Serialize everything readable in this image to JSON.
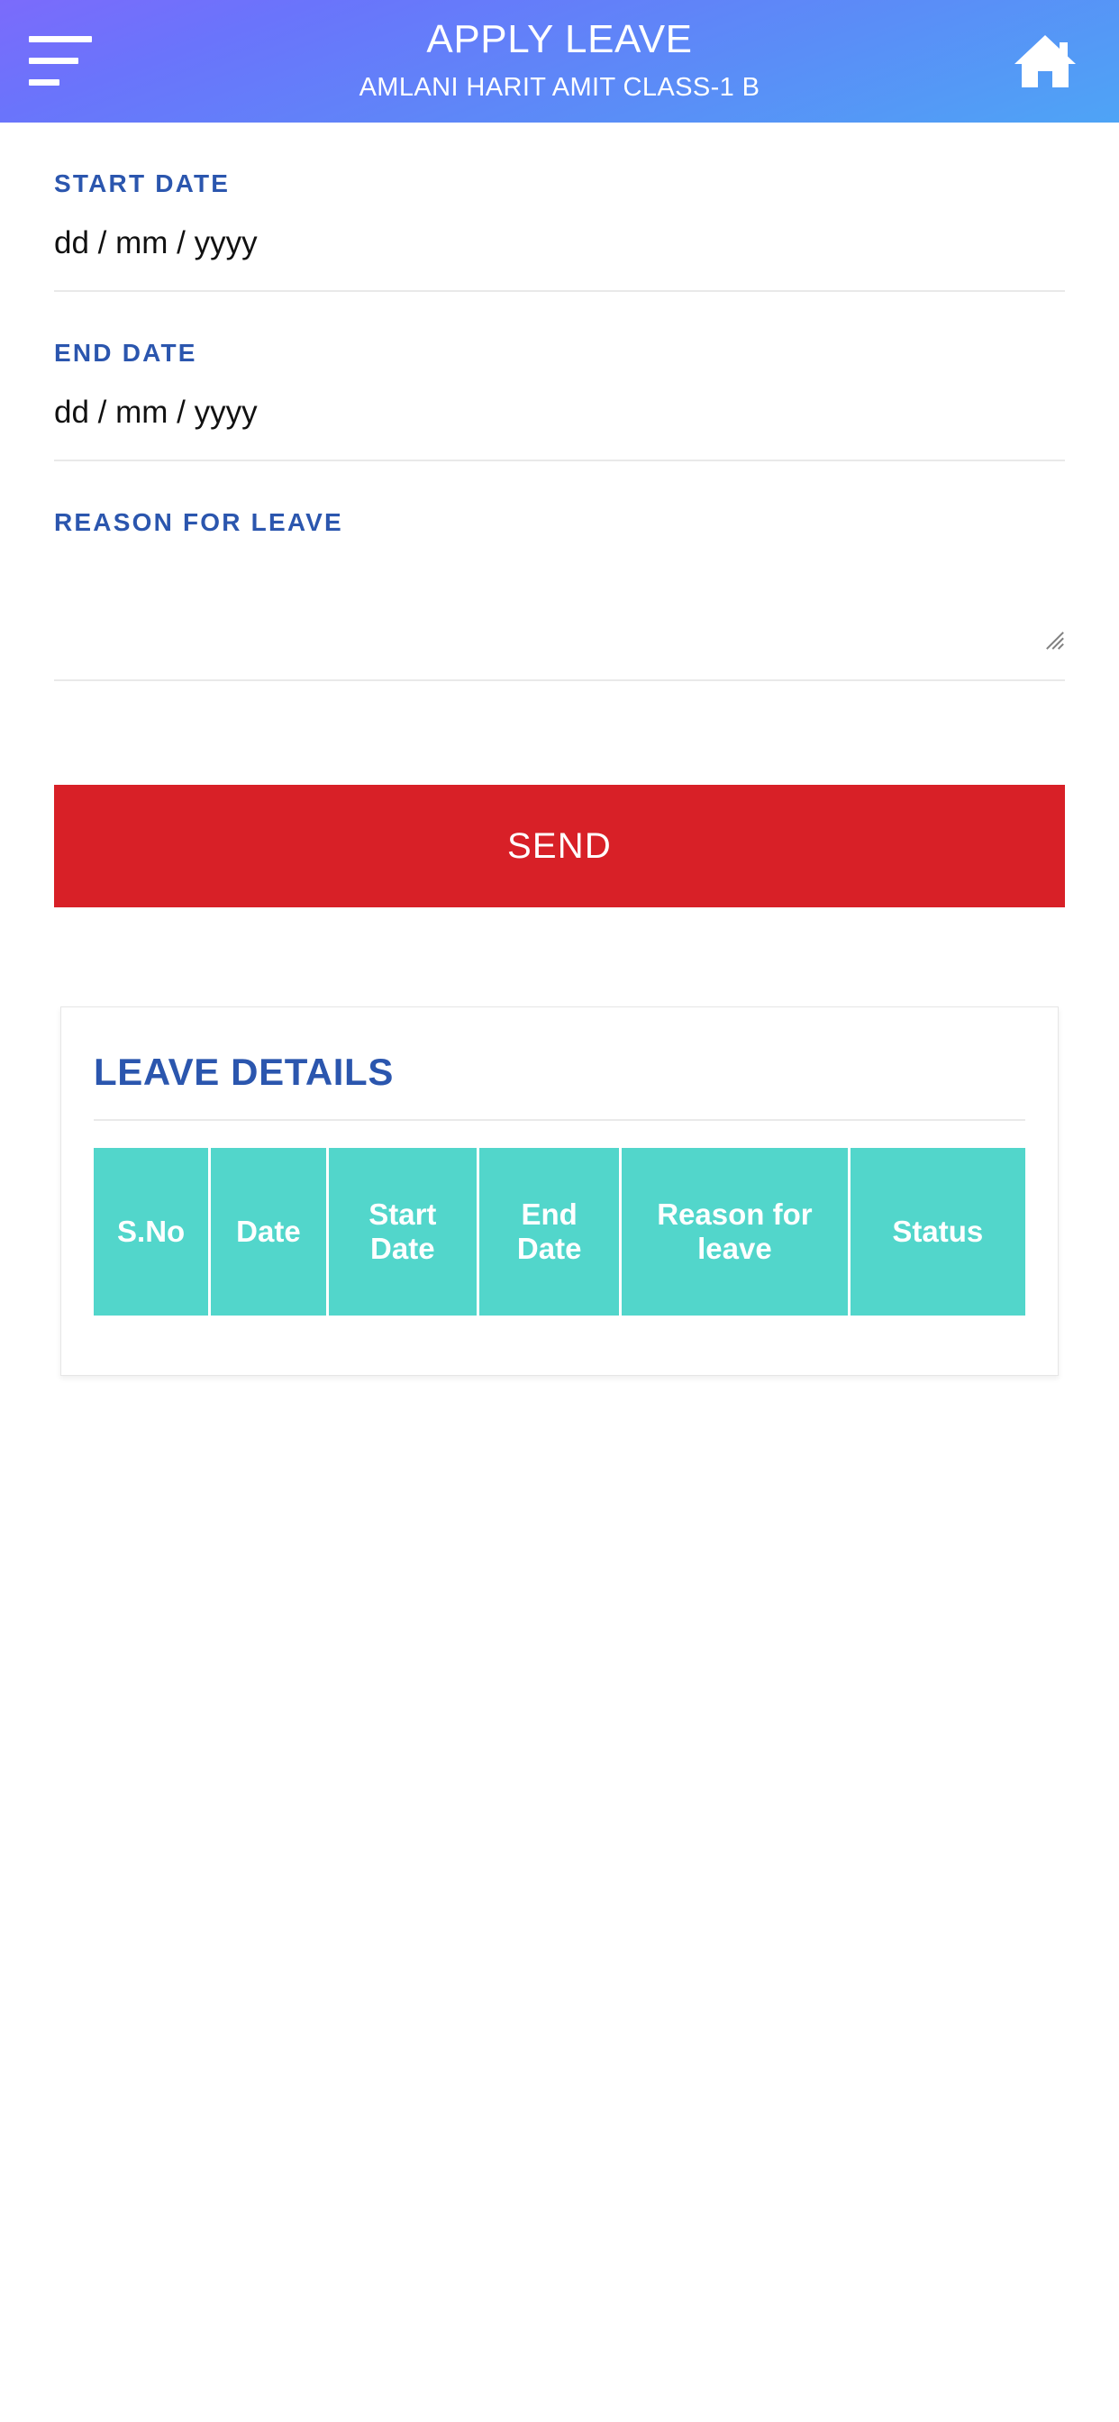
{
  "appbar": {
    "title": "APPLY LEAVE",
    "subtitle": "AMLANI HARIT AMIT CLASS-1 B",
    "menu_icon": "hamburger-menu-icon",
    "home_icon": "home-icon",
    "gradient_from": "#7b6bfb",
    "gradient_to": "#4ea4f6"
  },
  "form": {
    "start_date": {
      "label": "START DATE",
      "value": "",
      "placeholder": "dd / mm / yyyy"
    },
    "end_date": {
      "label": "END DATE",
      "value": "",
      "placeholder": "dd / mm / yyyy"
    },
    "reason": {
      "label": "REASON FOR LEAVE",
      "value": "",
      "placeholder": ""
    },
    "submit_label": "SEND",
    "submit_color": "#d82027",
    "label_color": "#2b56ae"
  },
  "leave_details": {
    "title": "LEAVE DETAILS",
    "header_color": "#52d6cb",
    "columns": [
      "S.No",
      "Date",
      "Start Date",
      "End Date",
      "Reason for leave",
      "Status"
    ],
    "rows": []
  }
}
